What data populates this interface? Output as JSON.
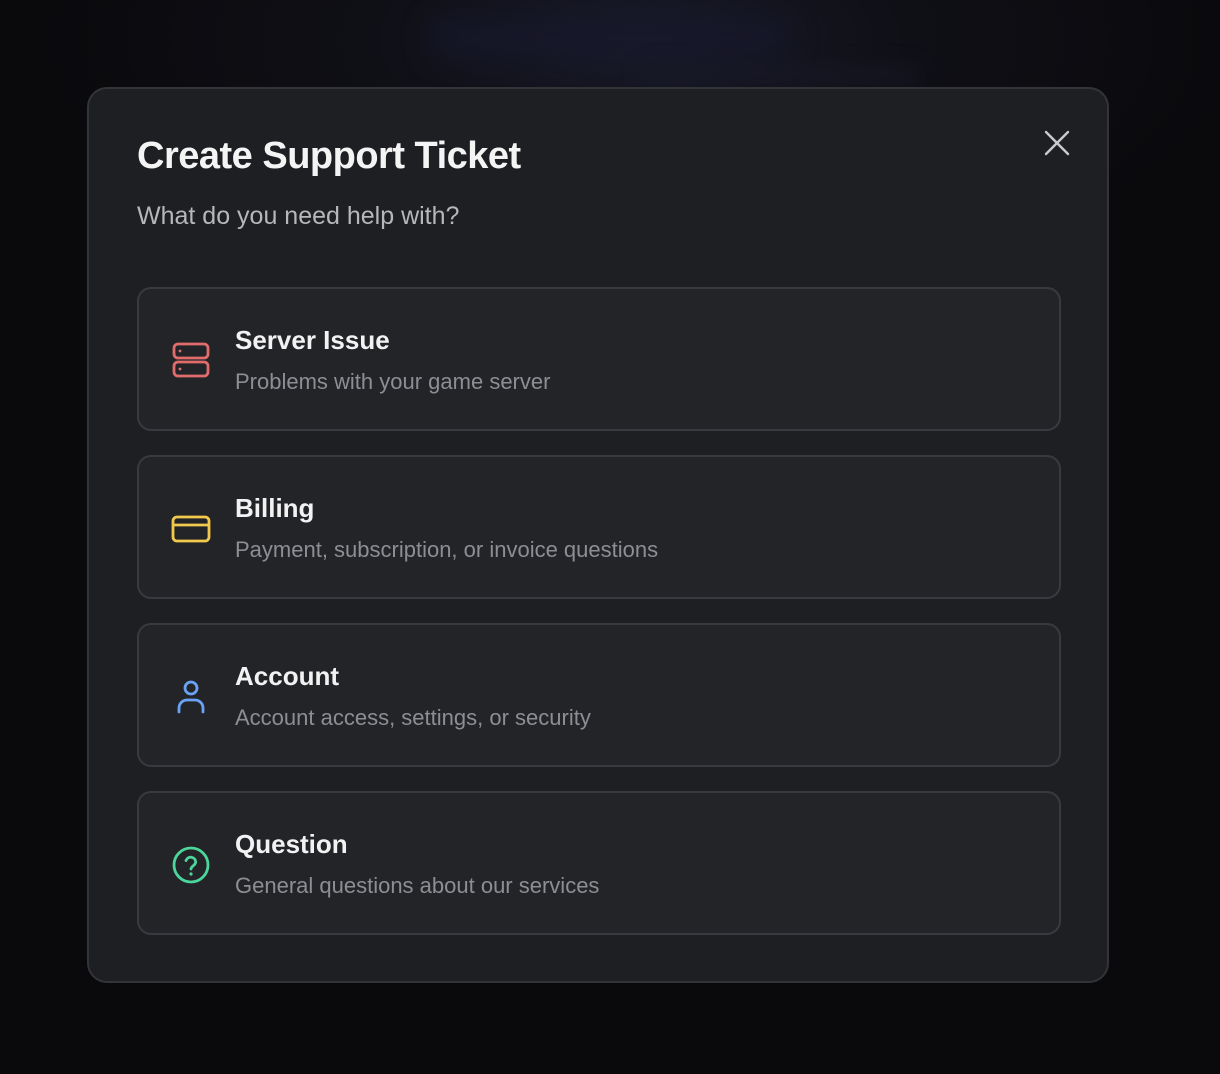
{
  "modal": {
    "title": "Create Support Ticket",
    "subtitle": "What do you need help with?",
    "close_icon": "close-icon"
  },
  "options": [
    {
      "title": "Server Issue",
      "description": "Problems with your game server",
      "icon": "server-icon",
      "color": "#e06c6c"
    },
    {
      "title": "Billing",
      "description": "Payment, subscription, or invoice questions",
      "icon": "credit-card-icon",
      "color": "#f2c94c"
    },
    {
      "title": "Account",
      "description": "Account access, settings, or security",
      "icon": "user-icon",
      "color": "#6aa3f5"
    },
    {
      "title": "Question",
      "description": "General questions about our services",
      "icon": "help-circle-icon",
      "color": "#4cd69c"
    }
  ]
}
